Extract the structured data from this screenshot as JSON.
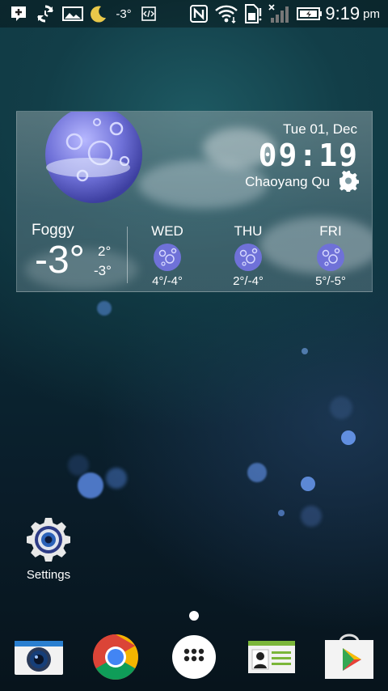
{
  "status_bar": {
    "temperature": "-3°",
    "time": "9:19",
    "ampm": "pm"
  },
  "weather_widget": {
    "date": "Tue 01, Dec",
    "clock": "09:19",
    "location": "Chaoyang Qu",
    "condition": "Foggy",
    "current_temp": "-3°",
    "high": "2°",
    "low": "-3°",
    "forecast": [
      {
        "day": "WED",
        "range": "4°/-4°"
      },
      {
        "day": "THU",
        "range": "2°/-4°"
      },
      {
        "day": "FRI",
        "range": "5°/-5°"
      }
    ]
  },
  "home": {
    "settings_label": "Settings"
  },
  "icons": {
    "moon": "moon-icon",
    "gear": "gear-icon",
    "settings": "settings-icon",
    "camera": "camera-icon",
    "chrome": "chrome-icon",
    "app_drawer": "app-drawer-icon",
    "contacts": "contacts-icon",
    "play_store": "play-store-icon"
  }
}
